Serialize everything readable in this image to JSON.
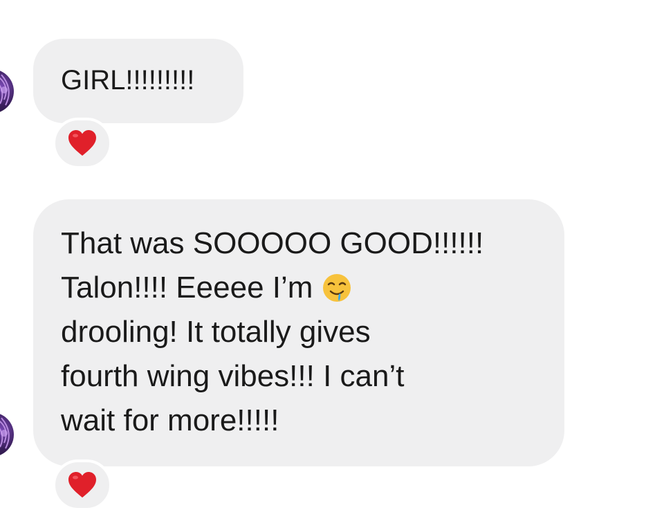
{
  "messages": [
    {
      "lines": [
        "GIRL!!!!!!!!!"
      ],
      "reaction": "red-heart-icon"
    },
    {
      "lines": [
        "That was SOOOOO GOOD!!!!!!",
        "Talon!!!! Eeeee I’m",
        "drooling! It totally gives",
        "fourth wing vibes!!! I can’t",
        "wait for more!!!!!"
      ],
      "inline_emoji": "drooling-face-icon",
      "reaction": "red-heart-icon"
    }
  ],
  "colors": {
    "bubble_bg": "#efeff0",
    "text": "#1a1a1a",
    "heart": "#e0202a",
    "emoji_face": "#f7c23c",
    "drool": "#3aa7e8"
  }
}
